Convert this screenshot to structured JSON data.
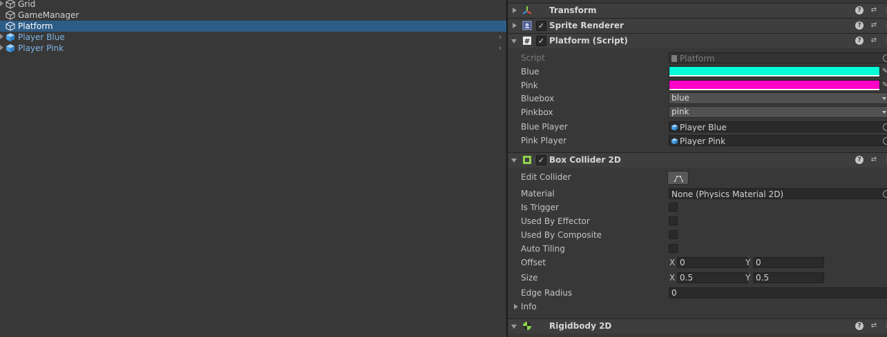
{
  "hierarchy": {
    "items": [
      {
        "label": "Grid",
        "type": "gameobject",
        "selected": false,
        "foldout": true,
        "arrow": false
      },
      {
        "label": "GameManager",
        "type": "gameobject",
        "selected": false,
        "foldout": false,
        "arrow": false
      },
      {
        "label": "Platform",
        "type": "gameobject",
        "selected": true,
        "foldout": false,
        "arrow": false
      },
      {
        "label": "Player Blue",
        "type": "prefab",
        "selected": false,
        "foldout": true,
        "arrow": true
      },
      {
        "label": "Player Pink",
        "type": "prefab",
        "selected": false,
        "foldout": true,
        "arrow": true
      }
    ],
    "child_arrow_icon": "chevron-right-icon"
  },
  "inspector": {
    "transform": {
      "title": "Transform",
      "icon": "transform-icon"
    },
    "sprite_renderer": {
      "title": "Sprite Renderer",
      "icon": "sprite-renderer-icon"
    },
    "platform_script": {
      "title": "Platform (Script)",
      "icon": "script-hash-icon",
      "props": {
        "script_label": "Script",
        "script_value": "Platform",
        "blue_label": "Blue",
        "blue_color": "#00ffd8",
        "pink_label": "Pink",
        "pink_color": "#ff00c8",
        "bluebox_label": "Bluebox",
        "bluebox_value": "blue",
        "pinkbox_label": "Pinkbox",
        "pinkbox_value": "pink",
        "blue_player_label": "Blue Player",
        "blue_player_value": "Player Blue",
        "pink_player_label": "Pink Player",
        "pink_player_value": "Player Pink"
      }
    },
    "box_collider": {
      "title": "Box Collider 2D",
      "icon": "box-collider-icon",
      "props": {
        "edit_collider_label": "Edit Collider",
        "material_label": "Material",
        "material_value": "None (Physics Material 2D)",
        "is_trigger_label": "Is Trigger",
        "used_by_effector_label": "Used By Effector",
        "used_by_composite_label": "Used By Composite",
        "auto_tiling_label": "Auto Tiling",
        "offset_label": "Offset",
        "offset_x_label": "X",
        "offset_x": "0",
        "offset_y_label": "Y",
        "offset_y": "0",
        "size_label": "Size",
        "size_x_label": "X",
        "size_x": "0.5",
        "size_y_label": "Y",
        "size_y": "0.5",
        "edge_radius_label": "Edge Radius",
        "edge_radius": "0",
        "info_label": "Info"
      }
    },
    "rigidbody": {
      "title": "Rigidbody 2D",
      "icon": "rigidbody-icon"
    },
    "header_buttons": {
      "help": "?",
      "preset": "⇄",
      "menu": "⋮"
    },
    "check_glyph": "✓"
  }
}
